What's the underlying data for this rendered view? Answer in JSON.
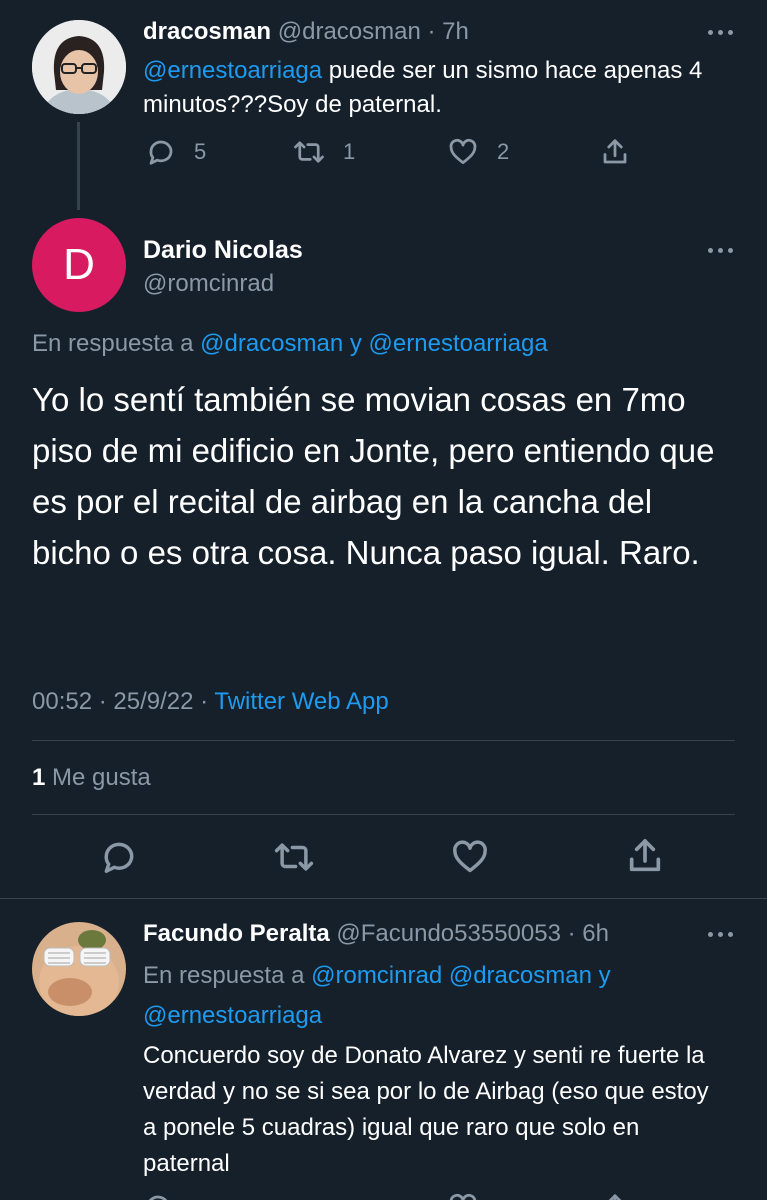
{
  "tweet1": {
    "name": "dracosman",
    "handle": "@dracosman",
    "time": "· 7h",
    "mention": "@ernestoarriaga",
    "text_after_mention": " puede ser un sismo hace apenas 4 minutos???Soy de paternal.",
    "replies": "5",
    "retweets": "1",
    "likes": "2"
  },
  "main": {
    "avatar_letter": "D",
    "avatar_color": "#d81b60",
    "name": "Dario Nicolas",
    "handle": "@romcinrad",
    "reply_prefix": "En respuesta a ",
    "reply_user1": "@dracosman",
    "reply_and": " y ",
    "reply_user2": "@ernestoarriaga",
    "text": "Yo lo sentí también se movian cosas en 7mo piso de mi edificio en Jonte, pero entiendo que es por el recital de airbag en la cancha del bicho o es otra cosa. Nunca paso igual. Raro.",
    "timestamp": "00:52 · 25/9/22 · ",
    "source": "Twitter Web App",
    "likes_count": "1",
    "likes_label": " Me gusta"
  },
  "tweet3": {
    "name": "Facundo Peralta",
    "handle": "@Facundo53550053",
    "time": "· 6h",
    "reply_prefix": "En respuesta a ",
    "reply_user1": "@romcinrad",
    "reply_user2": "@dracosman",
    "reply_and": " y",
    "reply_user3": "@ernestoarriaga",
    "text": "Concuerdo soy de Donato Alvarez y senti re fuerte la verdad y no se si sea por lo de Airbag (eso que estoy a ponele 5 cuadras) igual que raro que solo en paternal"
  },
  "colors": {
    "background": "#15202b",
    "link": "#1d9bf0",
    "muted": "#8b98a5",
    "divider": "#38444d"
  }
}
